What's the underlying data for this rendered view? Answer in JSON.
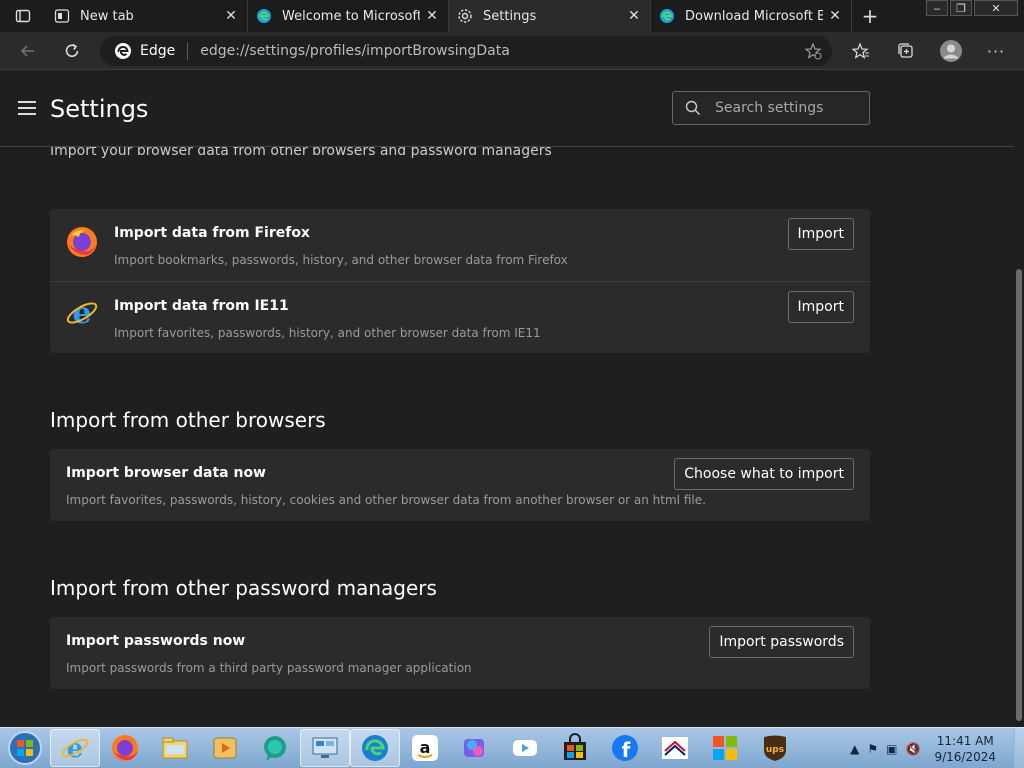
{
  "tabs": [
    {
      "title": "New tab",
      "icon": "newtab-icon",
      "active": false
    },
    {
      "title": "Welcome to Microsoft Ed",
      "icon": "edge-logo-icon",
      "active": false
    },
    {
      "title": "Settings",
      "icon": "gear-icon",
      "active": true
    },
    {
      "title": "Download Microsoft Edge",
      "icon": "edge-logo-icon",
      "active": false
    }
  ],
  "address": {
    "label": "Edge",
    "url": "edge://settings/profiles/importBrowsingData"
  },
  "settings": {
    "title": "Settings",
    "search_placeholder": "Search settings"
  },
  "intro": "Import your browser data from other browsers and password managers",
  "quick_import": [
    {
      "title": "Import data from Firefox",
      "desc": "Import bookmarks, passwords, history, and other browser data from Firefox",
      "button": "Import",
      "icon": "firefox-icon"
    },
    {
      "title": "Import data from IE11",
      "desc": "Import favorites, passwords, history, and other browser data from IE11",
      "button": "Import",
      "icon": "ie-icon"
    }
  ],
  "browsers_section": {
    "heading": "Import from other browsers",
    "title": "Import browser data now",
    "desc": "Import favorites, passwords, history, cookies and other browser data from another browser or an html file.",
    "button": "Choose what to import"
  },
  "passwords_section": {
    "heading": "Import from other password managers",
    "title": "Import passwords now",
    "desc": "Import passwords from a third party password manager application",
    "button": "Import passwords"
  },
  "clock": {
    "time": "11:41 AM",
    "date": "9/16/2024"
  },
  "colors": {
    "page_bg": "#1f1f1f",
    "card_bg": "#2b2b2b",
    "taskbar": "#8fb4da"
  }
}
